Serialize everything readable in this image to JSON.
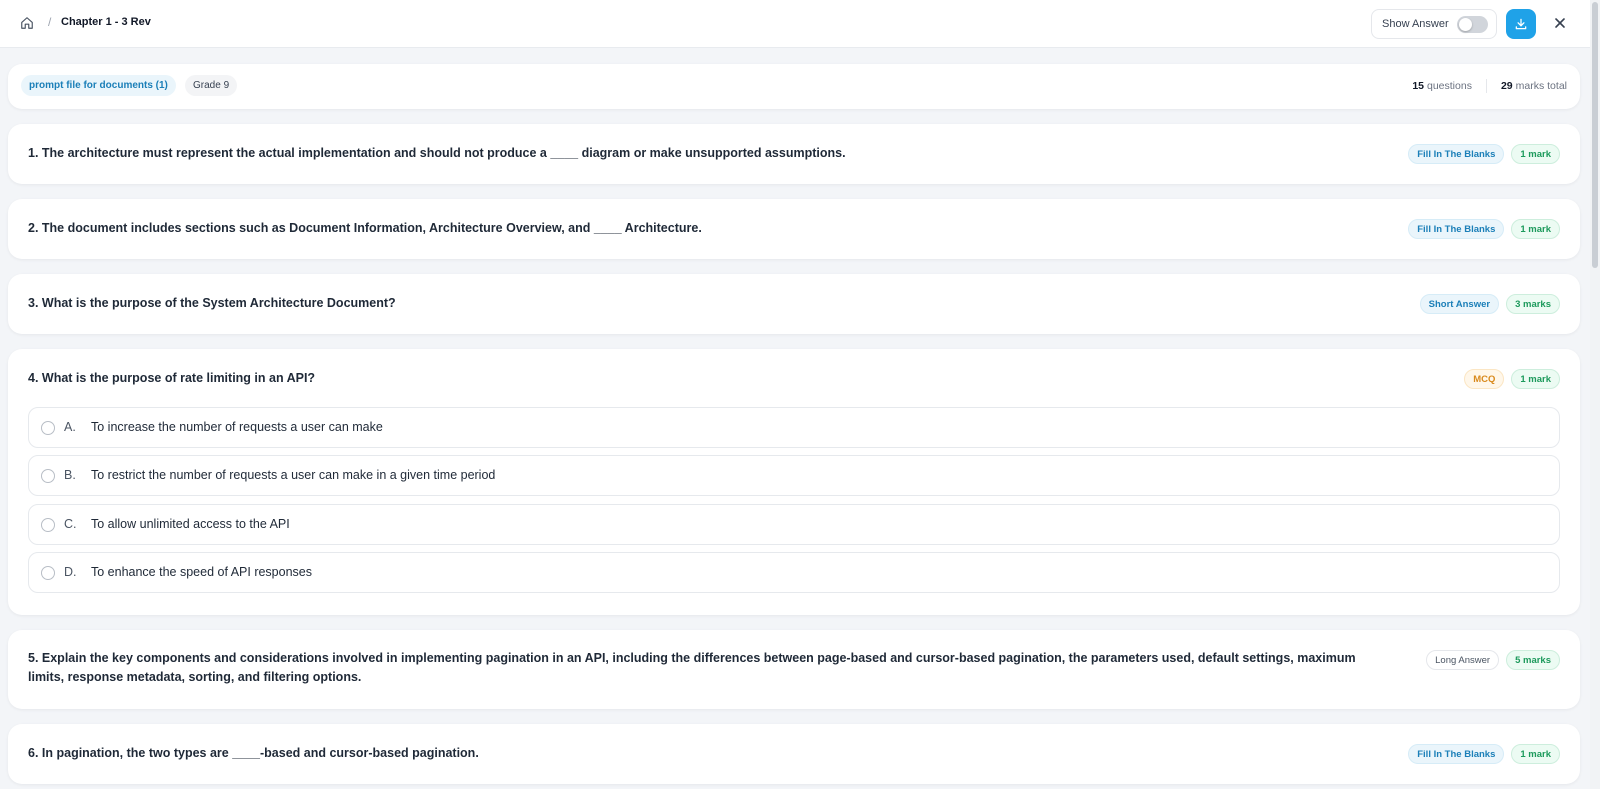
{
  "header": {
    "breadcrumb_sep": "/",
    "title": "Chapter 1 - 3 Rev",
    "show_answer_label": "Show Answer",
    "show_answer_on": false,
    "icons": {
      "home": "home-icon",
      "download": "download-icon",
      "close": "close-icon"
    }
  },
  "meta": {
    "source_tag": "prompt file for documents (1)",
    "grade_tag": "Grade 9",
    "questions_count": "15",
    "questions_label": "questions",
    "marks_count": "29",
    "marks_label": "marks total"
  },
  "questions": [
    {
      "text": "1. The architecture must represent the actual implementation and should not produce a ____ diagram or make unsupported assumptions.",
      "type": "Fill In The Blanks",
      "marks": "1 mark"
    },
    {
      "text": "2. The document includes sections such as Document Information, Architecture Overview, and ____ Architecture.",
      "type": "Fill In The Blanks",
      "marks": "1 mark"
    },
    {
      "text": "3. What is the purpose of the System Architecture Document?",
      "type": "Short Answer",
      "marks": "3 marks"
    },
    {
      "text": "4. What is the purpose of rate limiting in an API?",
      "type": "MCQ",
      "marks": "1 mark",
      "options": [
        {
          "letter": "A.",
          "text": "To increase the number of requests a user can make"
        },
        {
          "letter": "B.",
          "text": "To restrict the number of requests a user can make in a given time period"
        },
        {
          "letter": "C.",
          "text": "To allow unlimited access to the API"
        },
        {
          "letter": "D.",
          "text": "To enhance the speed of API responses"
        }
      ]
    },
    {
      "text": "5. Explain the key components and considerations involved in implementing pagination in an API, including the differences between page-based and cursor-based pagination, the parameters used, default settings, maximum limits, response metadata, sorting, and filtering options.",
      "type": "Long Answer",
      "marks": "5 marks"
    },
    {
      "text": "6. In pagination, the two types are ____-based and cursor-based pagination.",
      "type": "Fill In The Blanks",
      "marks": "1 mark"
    }
  ],
  "colors": {
    "accent": "#1fa2e8",
    "fill_badge": "#1b7fb8",
    "mcq_badge": "#d98a1d",
    "mark_badge": "#1d9a5c"
  }
}
